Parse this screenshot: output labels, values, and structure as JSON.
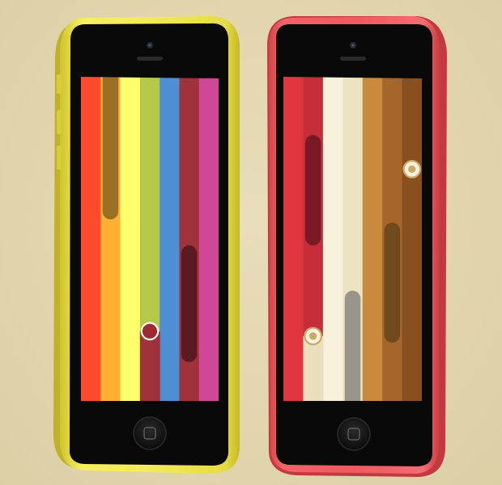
{
  "scene": {
    "background": "#e3d7b1"
  },
  "devices": [
    {
      "id": "phone-left",
      "body_color": "#f2ea55",
      "body_shade": "#cfc32c",
      "stripes": [
        "#ff4a2c",
        "#ffb134",
        "#ffff6e",
        "#b5c84a",
        "#4e8fd4",
        "#a0323c",
        "#d14797"
      ],
      "pills": [
        {
          "column": 1,
          "color": "#9a7124",
          "top": 0.0,
          "bottom": 0.44
        },
        {
          "column": 5,
          "color": "#5b1a22",
          "top": 0.52,
          "bottom": 0.88
        }
      ],
      "balls": [
        {
          "column": 3,
          "level": 0.785,
          "fill": "#9f2a34",
          "ring": "#ffffff"
        }
      ],
      "floors": [
        {
          "column": 3,
          "from": 0.785,
          "color": "#a0323c"
        }
      ],
      "icons": [
        "front-camera-icon",
        "earpiece-icon",
        "home-button-icon",
        "volume-up-button",
        "volume-down-button",
        "mute-switch"
      ]
    },
    {
      "id": "phone-right",
      "body_color": "#f0595f",
      "body_shade": "#c83a41",
      "stripes": [
        "#e0353f",
        "#c52d39",
        "#f8f1dc",
        "#ece3c3",
        "#c98a3e",
        "#a6652a",
        "#8a4f1f"
      ],
      "pills": [
        {
          "column": 1,
          "color": "#7a1a25",
          "top": 0.18,
          "bottom": 0.52
        },
        {
          "column": 3,
          "color": "#9a958a",
          "top": 0.66,
          "bottom": 1.0
        },
        {
          "column": 5,
          "color": "#6e4a1d",
          "top": 0.45,
          "bottom": 0.82
        }
      ],
      "balls": [
        {
          "column": 1,
          "level": 0.8,
          "fill": "#f8f1dc",
          "ring": "#c9a86a"
        },
        {
          "column": 6,
          "level": 0.285,
          "fill": "#f8f1dc",
          "ring": "#c9a86a"
        }
      ],
      "floors": [
        {
          "column": 1,
          "from": 0.8,
          "color": "#e9dfbf"
        }
      ],
      "icons": [
        "front-camera-icon",
        "earpiece-icon",
        "home-button-icon"
      ]
    }
  ]
}
